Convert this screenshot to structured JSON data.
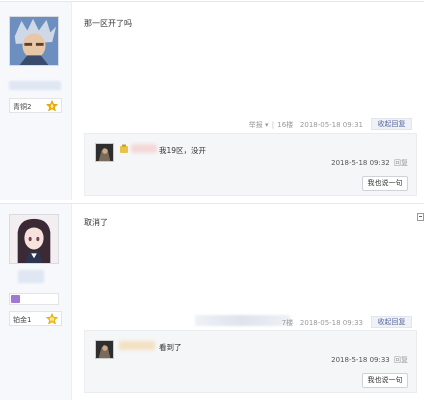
{
  "posts": [
    {
      "author": {
        "level": "青铜2"
      },
      "content": "那一区开了吗",
      "meta": {
        "report": "举报",
        "report_arrow": "▾",
        "sep": "|",
        "floor": "16楼",
        "time": "2018-05-18 09:31"
      },
      "reply_toggle": "收起回复",
      "replies": [
        {
          "text": "我19区，没开",
          "time": "2018-5-18 09:32",
          "reply_link": "回复"
        }
      ],
      "say_button": "我也说一句"
    },
    {
      "author": {
        "level": "铂金1"
      },
      "content": "取消了",
      "meta": {
        "floor": "7楼",
        "time": "2018-05-18 09:33"
      },
      "reply_toggle": "收起回复",
      "replies": [
        {
          "text": "看到了",
          "time": "2018-5-18 09:33",
          "reply_link": "回复"
        }
      ],
      "say_button": "我也说一句"
    }
  ],
  "colors": {
    "sidebar_bg": "#f6f8fb",
    "reply_panel_bg": "#f5f6f8",
    "toggle_text": "#5b6aa0",
    "level_gold": "#f0b400"
  }
}
